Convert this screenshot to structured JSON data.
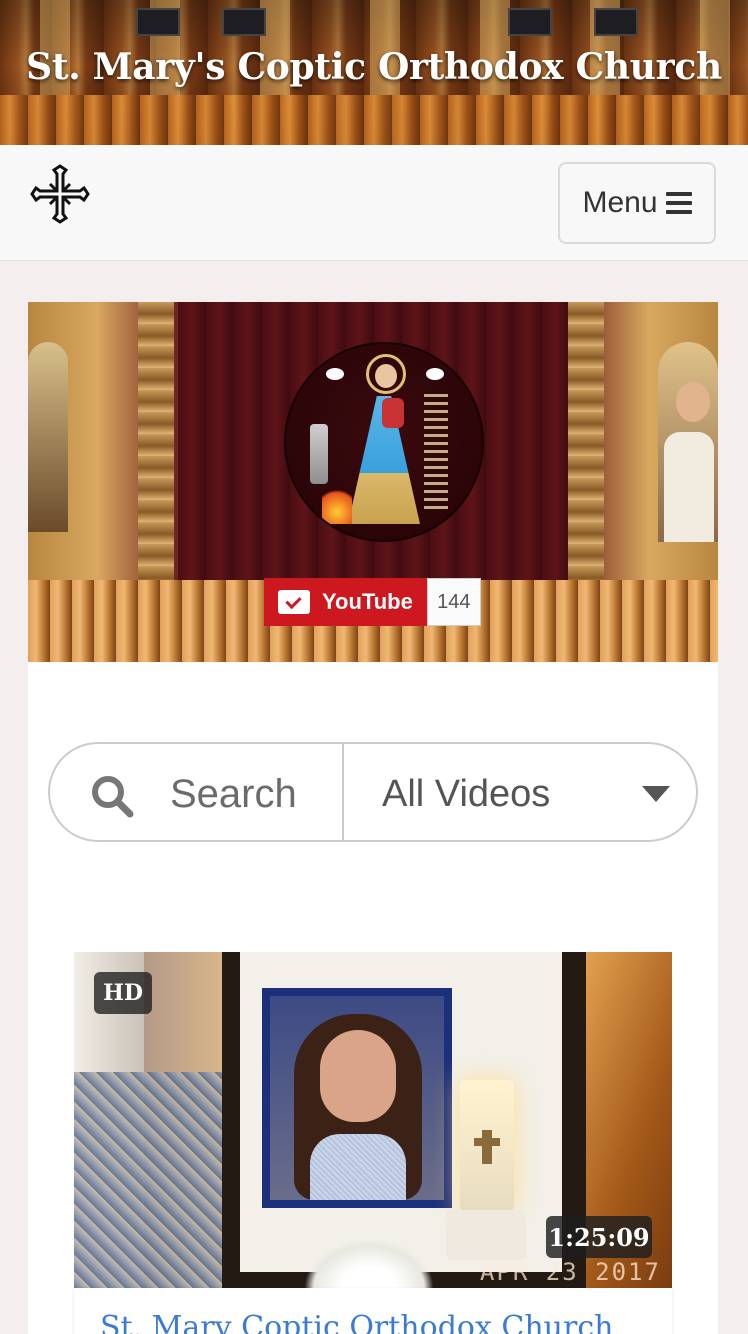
{
  "header": {
    "site_title": "St. Mary's Coptic Orthodox Church"
  },
  "nav": {
    "logo_icon": "coptic-cross-icon",
    "menu_label": "Menu",
    "menu_icon": "hamburger-icon"
  },
  "channel": {
    "subscribe_label": "YouTube",
    "subscriber_count": "144",
    "brand_color": "#cc181e"
  },
  "search": {
    "placeholder": "Search",
    "filter_selected": "All Videos"
  },
  "videos": [
    {
      "quality_badge": "HD",
      "duration": "1:25:09",
      "thumbnail_date_stamp": "APR 23 2017",
      "title": "St. Mary Coptic Orthodox Church",
      "title_color": "#3a7bd5"
    }
  ]
}
